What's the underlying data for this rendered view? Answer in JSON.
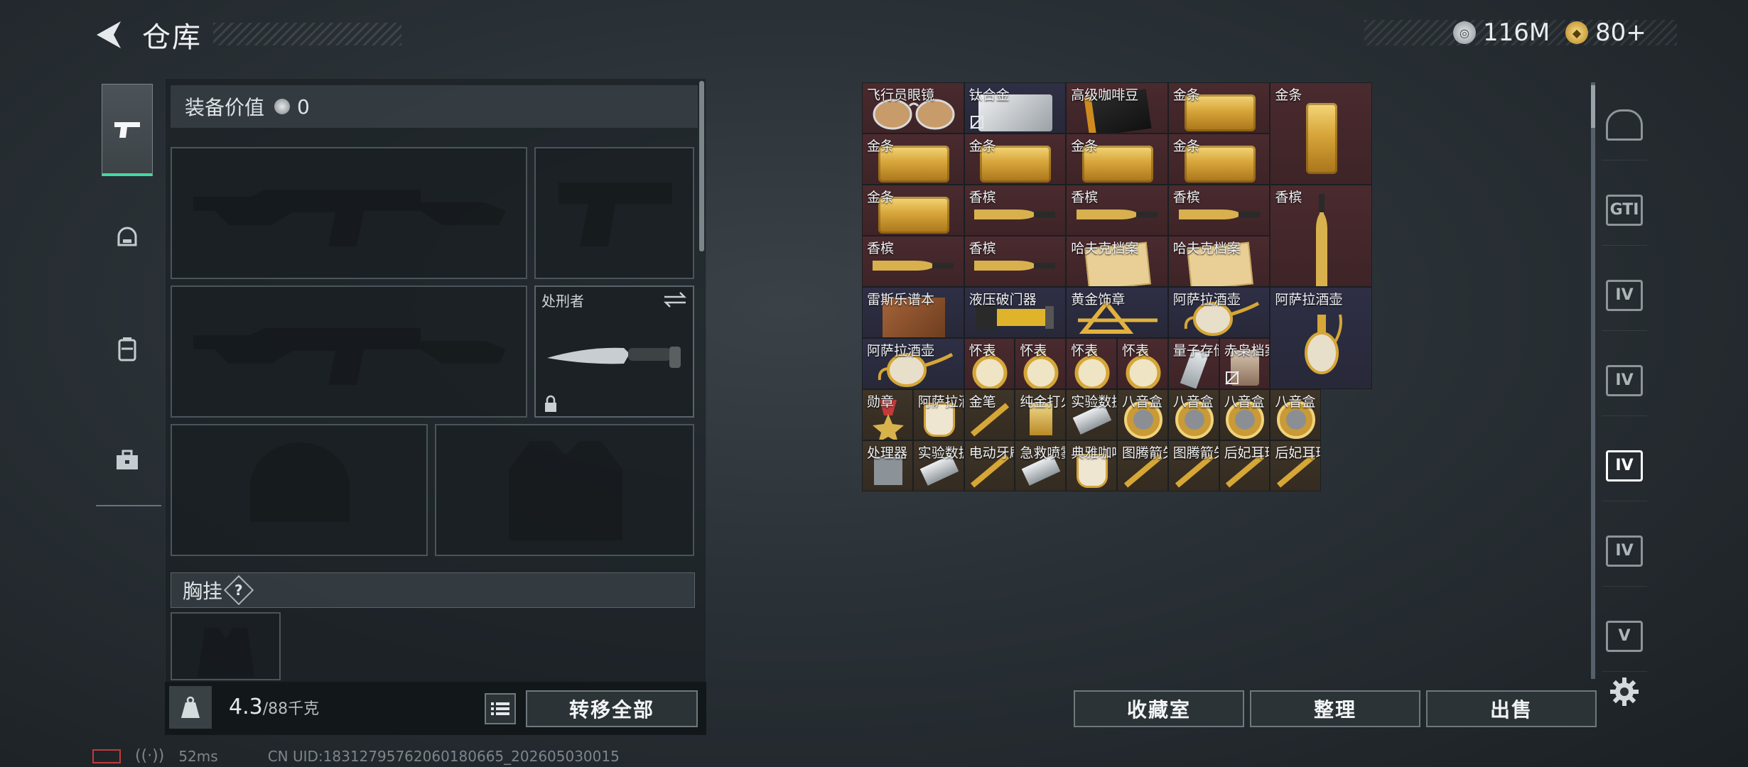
{
  "header": {
    "title": "仓库",
    "currency": [
      {
        "icon": "silver-coin-icon",
        "value": "116M",
        "color": "#c9ced2"
      },
      {
        "icon": "gold-coin-icon",
        "value": "80+",
        "color": "#d4a837"
      }
    ]
  },
  "left_nav": [
    {
      "name": "nav-weapons",
      "icon": "pistol-icon",
      "active": true
    },
    {
      "name": "nav-armor",
      "icon": "helmet-icon"
    },
    {
      "name": "nav-backpack",
      "icon": "backpack-icon"
    },
    {
      "name": "nav-toolbox",
      "icon": "toolbox-icon"
    }
  ],
  "loadout": {
    "equipment_value_label": "装备价值",
    "equipment_value": "0",
    "melee_label": "处刑者",
    "chest_rig_label": "胸挂",
    "chest_rig_help": "?"
  },
  "weight": {
    "current": "4.3",
    "max": "/88千克",
    "icon": "weight-icon"
  },
  "buttons": {
    "transfer_all": "转移全部",
    "collection": "收藏室",
    "organize": "整理",
    "sell": "出售"
  },
  "items": [
    {
      "name": "飞行员眼镜",
      "tier": "gold",
      "kind": "glasses"
    },
    {
      "name": "钛合金",
      "tier": "purp",
      "kind": "metal",
      "badge": true
    },
    {
      "name": "高级咖啡豆",
      "tier": "gold",
      "kind": "coffee"
    },
    {
      "name": "金条",
      "tier": "gold",
      "kind": "bar"
    },
    {
      "name": "金条",
      "tier": "gold",
      "kind": "vbar"
    },
    {
      "name": "金条",
      "tier": "gold",
      "kind": "bar"
    },
    {
      "name": "金条",
      "tier": "gold",
      "kind": "bar"
    },
    {
      "name": "金条",
      "tier": "gold",
      "kind": "bar"
    },
    {
      "name": "金条",
      "tier": "gold",
      "kind": "bar"
    },
    {
      "name": "金条",
      "tier": "gold",
      "kind": "bar"
    },
    {
      "name": "香槟",
      "tier": "gold",
      "kind": "bottle"
    },
    {
      "name": "香槟",
      "tier": "gold",
      "kind": "bottle"
    },
    {
      "name": "香槟",
      "tier": "gold",
      "kind": "bottle"
    },
    {
      "name": "香槟",
      "tier": "gold",
      "kind": "vbottle"
    },
    {
      "name": "香槟",
      "tier": "gold",
      "kind": "bottle"
    },
    {
      "name": "香槟",
      "tier": "gold",
      "kind": "bottle"
    },
    {
      "name": "哈夫克档案",
      "tier": "gold",
      "kind": "file"
    },
    {
      "name": "哈夫克档案",
      "tier": "gold",
      "kind": "file"
    },
    {
      "name": "雷斯乐谱本",
      "tier": "purp",
      "kind": "book"
    },
    {
      "name": "液压破门器",
      "tier": "purp",
      "kind": "breacher"
    },
    {
      "name": "黄金饰章",
      "tier": "purp",
      "kind": "emblem"
    },
    {
      "name": "阿萨拉酒壶",
      "tier": "purp",
      "kind": "ewer"
    },
    {
      "name": "阿萨拉酒壶",
      "tier": "purp",
      "kind": "vewer"
    },
    {
      "name": "阿萨拉酒壶",
      "tier": "purp",
      "kind": "ewer"
    },
    {
      "name": "怀表",
      "tier": "gold",
      "kind": "watch"
    },
    {
      "name": "怀表",
      "tier": "gold",
      "kind": "watch"
    },
    {
      "name": "怀表",
      "tier": "gold",
      "kind": "watch"
    },
    {
      "name": "怀表",
      "tier": "gold",
      "kind": "watch"
    },
    {
      "name": "量子存储",
      "tier": "gold",
      "kind": "usb"
    },
    {
      "name": "赤枭档案",
      "tier": "gold",
      "kind": "jar",
      "badge": true
    },
    {
      "name": "勋章",
      "tier": "brn",
      "kind": "medal"
    },
    {
      "name": "阿萨拉酒杯",
      "tier": "brn",
      "kind": "cup"
    },
    {
      "name": "金笔",
      "tier": "brn",
      "kind": "pen"
    },
    {
      "name": "纯金打火机",
      "tier": "brn",
      "kind": "lighter"
    },
    {
      "name": "实验数据...",
      "tier": "brn",
      "kind": "drive"
    },
    {
      "name": "八音盒",
      "tier": "brn",
      "kind": "box"
    },
    {
      "name": "八音盒",
      "tier": "brn",
      "kind": "box"
    },
    {
      "name": "八音盒",
      "tier": "brn",
      "kind": "box"
    },
    {
      "name": "八音盒",
      "tier": "brn",
      "kind": "box"
    },
    {
      "name": "处理器",
      "tier": "brn",
      "kind": "chip"
    },
    {
      "name": "实验数据...",
      "tier": "brn",
      "kind": "drive"
    },
    {
      "name": "电动牙刷",
      "tier": "brn",
      "kind": "pen"
    },
    {
      "name": "急救喷雾",
      "tier": "brn",
      "kind": "drive"
    },
    {
      "name": "典雅咖啡杯",
      "tier": "brn",
      "kind": "cup"
    },
    {
      "name": "图腾箭矢",
      "tier": "brn",
      "kind": "pen"
    },
    {
      "name": "图腾箭矢",
      "tier": "brn",
      "kind": "pen"
    },
    {
      "name": "后妃耳环",
      "tier": "brn",
      "kind": "pen"
    },
    {
      "name": "后妃耳环",
      "tier": "brn",
      "kind": "pen"
    }
  ],
  "right_nav": [
    {
      "icon": "vault-icon",
      "text": ""
    },
    {
      "icon": "box-case-icon",
      "text": "GTI"
    },
    {
      "icon": "case-iv-icon",
      "text": "IV"
    },
    {
      "icon": "case-iv-icon",
      "text": "IV"
    },
    {
      "icon": "case-iv-icon",
      "text": "IV",
      "active": true
    },
    {
      "icon": "case-iv-icon",
      "text": "IV"
    },
    {
      "icon": "case-v-icon",
      "text": "V"
    }
  ],
  "footer": {
    "ping": "52ms",
    "uid": "CN UID:18312795762060180665_202605030015"
  }
}
